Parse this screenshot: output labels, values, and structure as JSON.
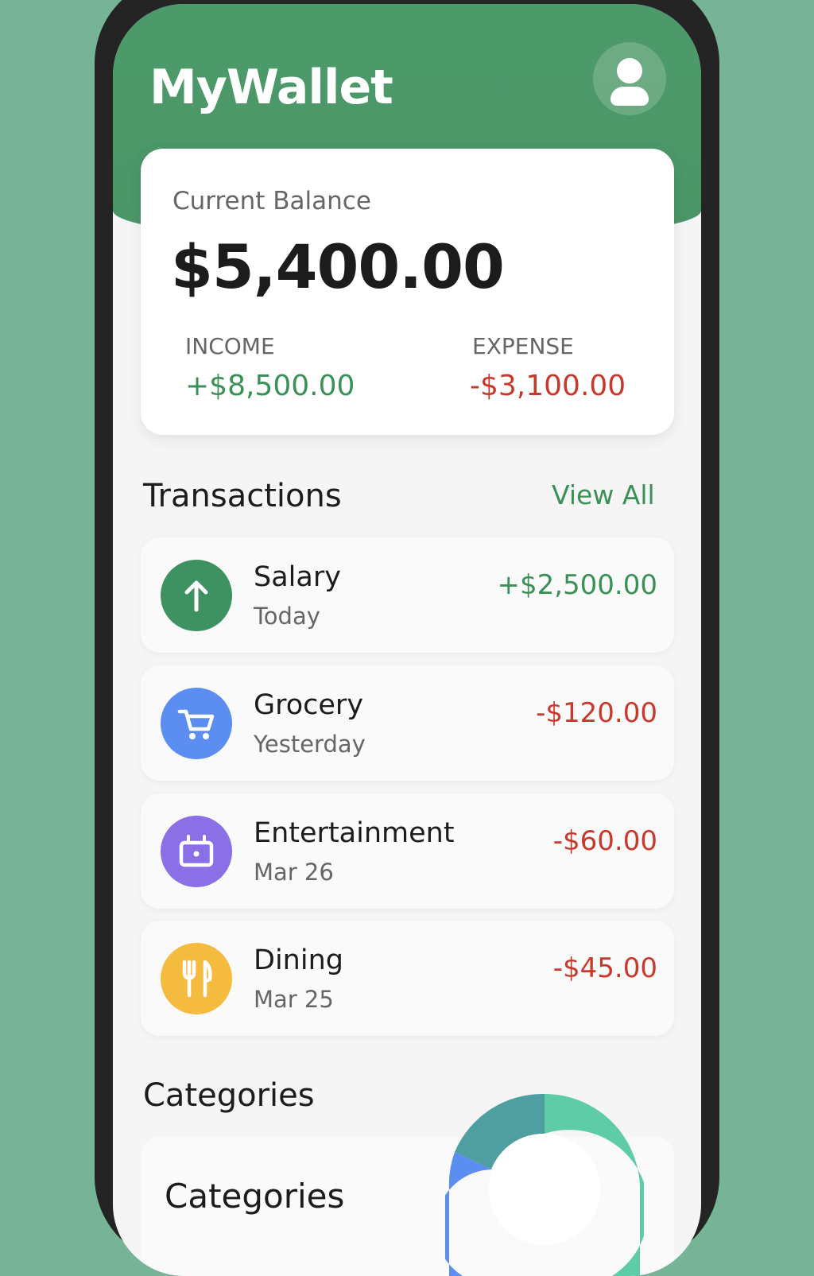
{
  "colors": {
    "brand": "#4c9a6a",
    "income": "#3a9158",
    "expense": "#c8392b",
    "salary_icon_bg": "#3e9160",
    "grocery_icon_bg": "#5b8ef0",
    "entertainment_icon_bg": "#8a6fe6",
    "dining_icon_bg": "#f5bb3f"
  },
  "header": {
    "title": "MyWallet",
    "avatar_icon": "user-icon"
  },
  "balance": {
    "label": "Current Balance",
    "amount": "$5,400.00",
    "income_label": "INCOME",
    "income_value": "+$8,500.00",
    "expense_label": "EXPENSE",
    "expense_value": "-$3,100.00"
  },
  "transactions": {
    "title": "Transactions",
    "view_all": "View All",
    "items": [
      {
        "name": "Salary",
        "date": "Today",
        "amount": "+$2,500.00",
        "icon": "arrow-up-icon",
        "type": "income"
      },
      {
        "name": "Grocery",
        "date": "Yesterday",
        "amount": "-$120.00",
        "icon": "shopping-cart-icon",
        "type": "expense"
      },
      {
        "name": "Entertainment",
        "date": "Mar 26",
        "amount": "-$60.00",
        "icon": "tv-icon",
        "type": "expense"
      },
      {
        "name": "Dining",
        "date": "Mar 25",
        "amount": "-$45.00",
        "icon": "fork-knife-icon",
        "type": "expense"
      }
    ]
  },
  "categories": {
    "title": "Categories",
    "card_title": "Categories",
    "chart_icon": "donut-chart-icon",
    "segment_colors": [
      "#5fcca8",
      "#4f9fa0",
      "#5b8ef0"
    ]
  }
}
